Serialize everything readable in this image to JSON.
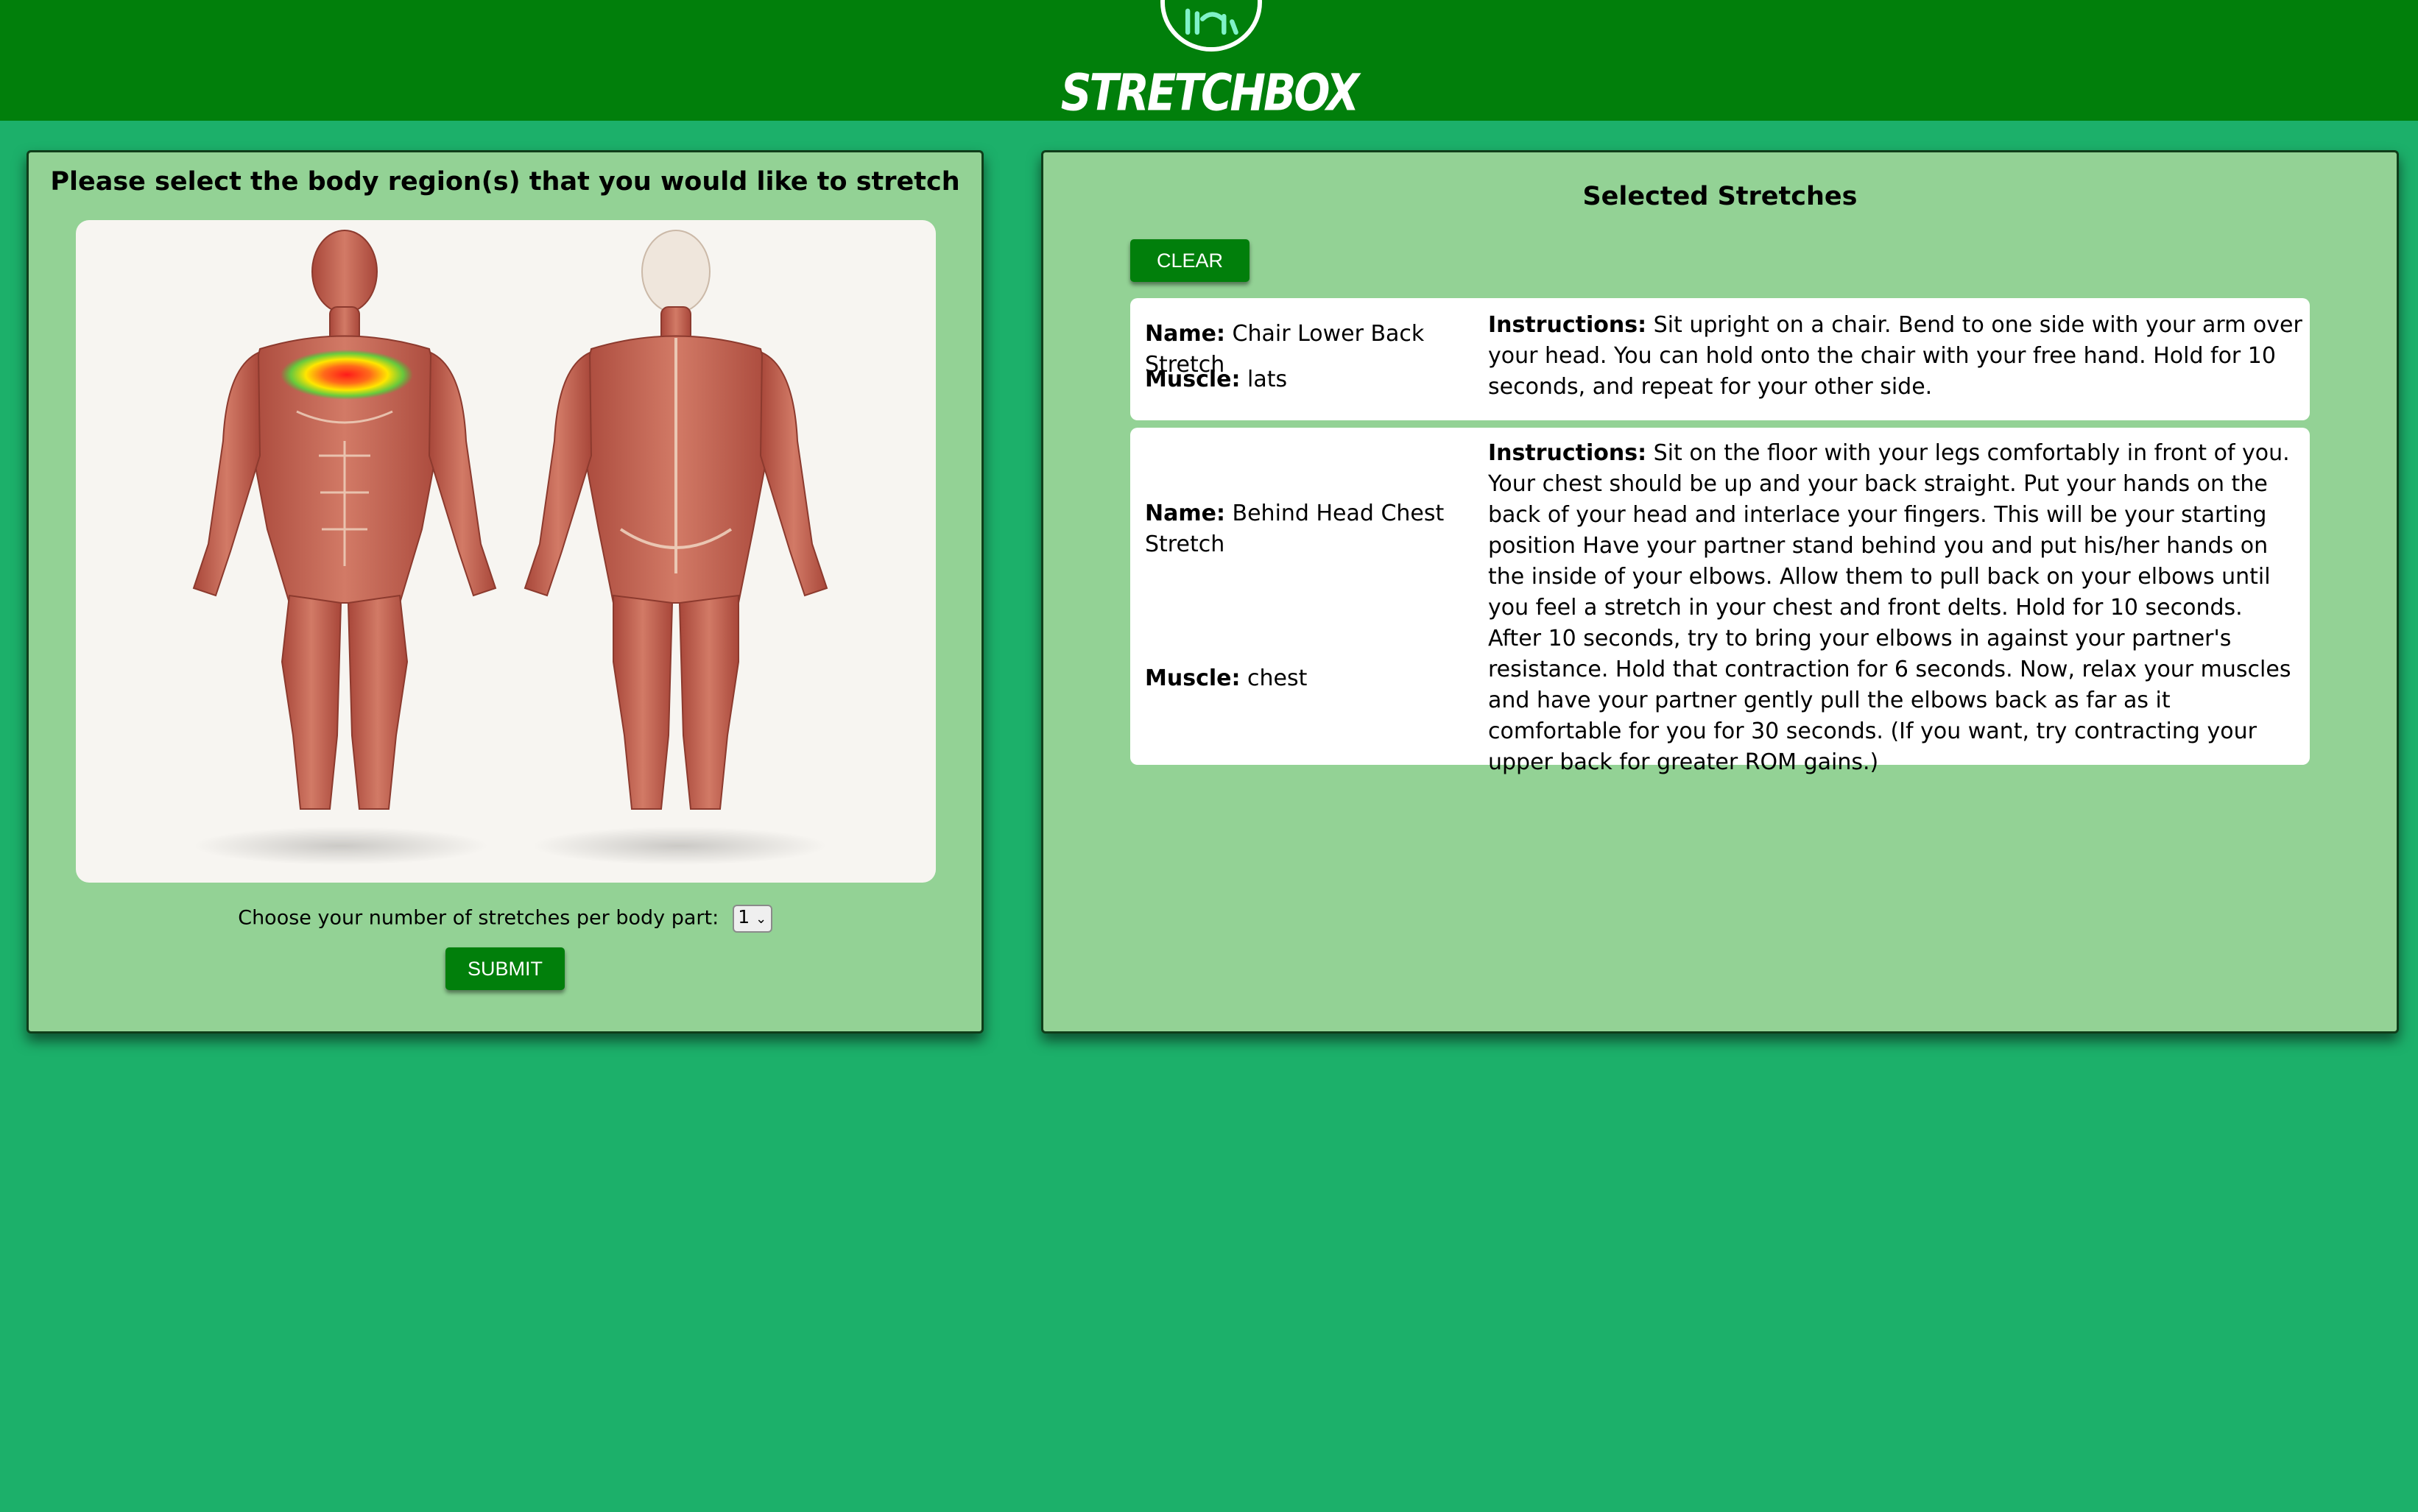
{
  "header": {
    "app_name": "STRETCHBOX",
    "logo_icon": "stretching-person-icon"
  },
  "selector": {
    "title": "Please select the body region(s) that you would like to stretch",
    "highlighted_region": "chest",
    "highlight_colors": [
      "#ff1a1a",
      "#ffe600",
      "#33cc33"
    ],
    "stretches_label": "Choose your number of stretches per body part:",
    "stretches_value": "1",
    "submit_label": "SUBMIT"
  },
  "selected": {
    "title": "Selected Stretches",
    "clear_label": "CLEAR",
    "name_label": "Name:",
    "muscle_label": "Muscle:",
    "instructions_label": "Instructions:",
    "stretches": [
      {
        "name": "Chair Lower Back Stretch",
        "muscle": "lats",
        "instructions": "Sit upright on a chair. Bend to one side with your arm over your head. You can hold onto the chair with your free hand. Hold for 10 seconds, and repeat for your other side."
      },
      {
        "name": "Behind Head Chest Stretch",
        "muscle": "chest",
        "instructions": "Sit on the floor with your legs comfortably in front of you. Your chest should be up and your back straight. Put your hands on the back of your head and interlace your fingers. This will be your starting position Have your partner stand behind you and put his/her hands on the inside of your elbows. Allow them to pull back on your elbows until you feel a stretch in your chest and front delts. Hold for 10 seconds. After 10 seconds, try to bring your elbows in against your partner's resistance. Hold that contraction for 6 seconds. Now, relax your muscles and have your partner gently pull the elbows back as far as it comfortable for you for 30 seconds. (If you want, try contracting your upper back for greater ROM gains.)"
      }
    ]
  }
}
